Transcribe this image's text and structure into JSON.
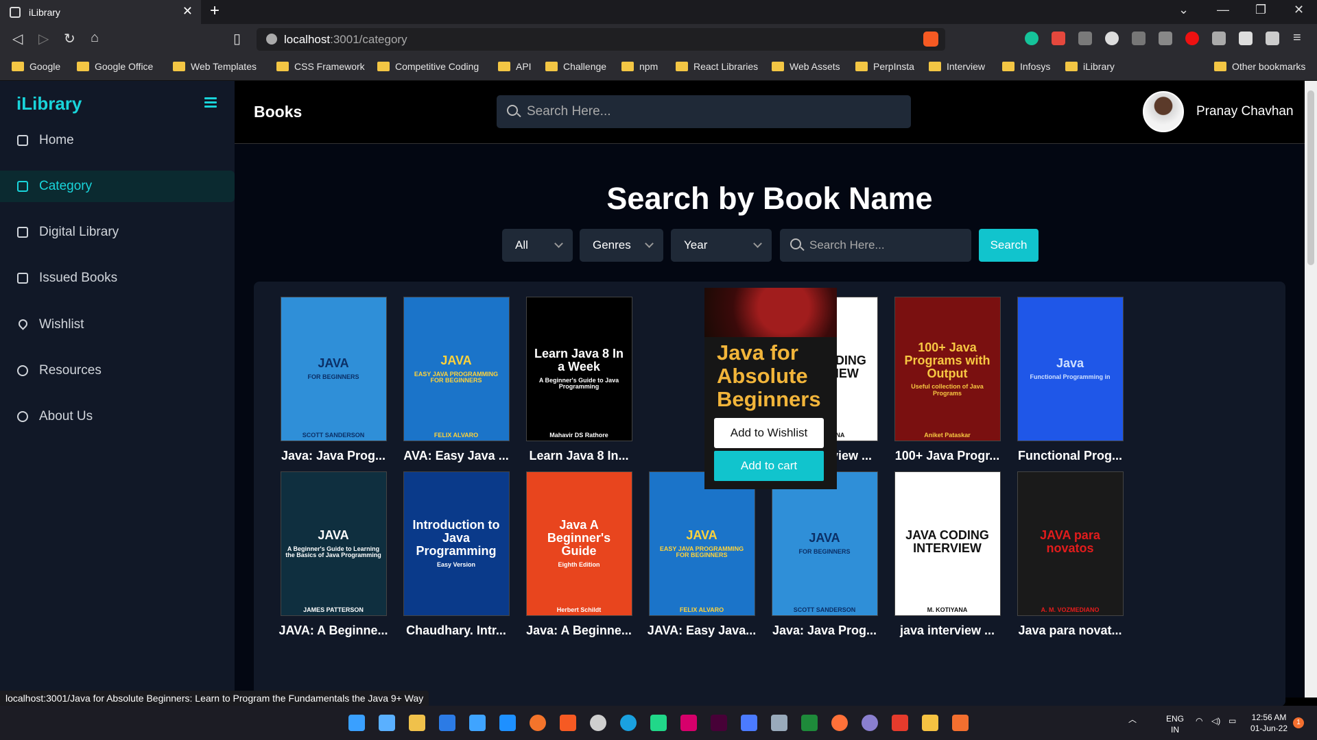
{
  "browser": {
    "tab_title": "iLibrary",
    "address_host": "localhost",
    "address_path": ":3001/category",
    "bookmarks": [
      "Google",
      "Google Office",
      "Web Templates",
      "CSS Framework",
      "Competitive Coding",
      "API",
      "Challenge",
      "npm",
      "React Libraries",
      "Web Assets",
      "PerpInsta",
      "Interview",
      "Infosys",
      "iLibrary",
      "Other bookmarks"
    ],
    "status_url": "localhost:3001/Java for Absolute Beginners: Learn to Program the Fundamentals the Java 9+ Way"
  },
  "sidebar": {
    "logo": "iLibrary",
    "items": [
      {
        "label": "Home",
        "icon": "home-icon"
      },
      {
        "label": "Category",
        "icon": "grid-icon",
        "active": true
      },
      {
        "label": "Digital Library",
        "icon": "library-icon"
      },
      {
        "label": "Issued Books",
        "icon": "issued-icon"
      },
      {
        "label": "Wishlist",
        "icon": "heart-icon"
      },
      {
        "label": "Resources",
        "icon": "gear-icon"
      },
      {
        "label": "About Us",
        "icon": "question-icon"
      }
    ]
  },
  "header": {
    "title": "Books",
    "search_placeholder": "Search Here...",
    "user_name": "Pranay Chavhan"
  },
  "search_section": {
    "title": "Search by Book Name",
    "filter_all": "All",
    "filter_genres": "Genres",
    "filter_year": "Year",
    "search_placeholder": "Search Here...",
    "search_button": "Search"
  },
  "books_row1": [
    {
      "title": "Java: Java Prog...",
      "cover_title": "JAVA",
      "cover_sub": "FOR BEGINNERS",
      "cover_author": "SCOTT SANDERSON",
      "bg": "#2f8fd8",
      "fg": "#0b2f66"
    },
    {
      "title": "AVA: Easy Java ...",
      "cover_title": "JAVA",
      "cover_sub": "EASY JAVA PROGRAMMING FOR BEGINNERS",
      "cover_author": "FELIX ALVARO",
      "bg": "#1b74c9",
      "fg": "#ffd33a"
    },
    {
      "title": "Learn Java 8 In...",
      "cover_title": "Learn Java 8 In a Week",
      "cover_sub": "A Beginner's Guide to Java Programming",
      "cover_author": "Mahavir DS Rathore",
      "bg": "#000000",
      "fg": "#ffffff"
    },
    {
      "title": "",
      "cover_title": "",
      "cover_sub": "",
      "cover_author": "",
      "bg": "#161616",
      "fg": "#f2b53a"
    },
    {
      "title": "java interview ...",
      "cover_title": "JAVA CODING INTERVIEW",
      "cover_sub": "",
      "cover_author": "M. KOTIYANA",
      "bg": "#ffffff",
      "fg": "#111111"
    },
    {
      "title": "100+ Java Progr...",
      "cover_title": "100+ Java Programs with Output",
      "cover_sub": "Useful collection of Java Programs",
      "cover_author": "Aniket Pataskar",
      "bg": "#7a1010",
      "fg": "#f7c742"
    },
    {
      "title": "Functional Prog...",
      "cover_title": "Java",
      "cover_sub": "Functional Programming in",
      "cover_author": "",
      "bg": "#1f57e8",
      "fg": "#cfe0ff"
    }
  ],
  "books_row2": [
    {
      "title": "JAVA: A Beginne...",
      "cover_title": "JAVA",
      "cover_sub": "A Beginner's Guide to Learning the Basics of Java Programming",
      "cover_author": "JAMES PATTERSON",
      "bg": "#0f2f3f",
      "fg": "#ffffff"
    },
    {
      "title": "Chaudhary. Intr...",
      "cover_title": "Introduction to Java Programming",
      "cover_sub": "Easy Version",
      "cover_author": "",
      "bg": "#0a3a8a",
      "fg": "#ffffff"
    },
    {
      "title": "Java: A Beginne...",
      "cover_title": "Java A Beginner's Guide",
      "cover_sub": "Eighth Edition",
      "cover_author": "Herbert Schildt",
      "bg": "#e8451e",
      "fg": "#ffffff"
    },
    {
      "title": "JAVA: Easy Java...",
      "cover_title": "JAVA",
      "cover_sub": "EASY JAVA PROGRAMMING FOR BEGINNERS",
      "cover_author": "FELIX ALVARO",
      "bg": "#1b74c9",
      "fg": "#ffd33a"
    },
    {
      "title": "Java: Java Prog...",
      "cover_title": "JAVA",
      "cover_sub": "FOR BEGINNERS",
      "cover_author": "SCOTT SANDERSON",
      "bg": "#2f8fd8",
      "fg": "#0b2f66"
    },
    {
      "title": "java interview ...",
      "cover_title": "JAVA CODING INTERVIEW",
      "cover_sub": "",
      "cover_author": "M. KOTIYANA",
      "bg": "#ffffff",
      "fg": "#111111"
    },
    {
      "title": "Java para novat...",
      "cover_title": "JAVA para novatos",
      "cover_sub": "",
      "cover_author": "A. M. VOZMEDIANO",
      "bg": "#1a1a1a",
      "fg": "#e21c1c"
    }
  ],
  "hover_book": {
    "cover_title": "Java for Absolute Beginners",
    "wishlist_button": "Add to Wishlist",
    "cart_button": "Add to cart"
  },
  "taskbar": {
    "lang": "ENG",
    "region": "IN",
    "time": "12:56 AM",
    "date": "01-Jun-22",
    "notifications": "1"
  },
  "colors": {
    "accent": "#19d4da",
    "button": "#11c4cd"
  }
}
